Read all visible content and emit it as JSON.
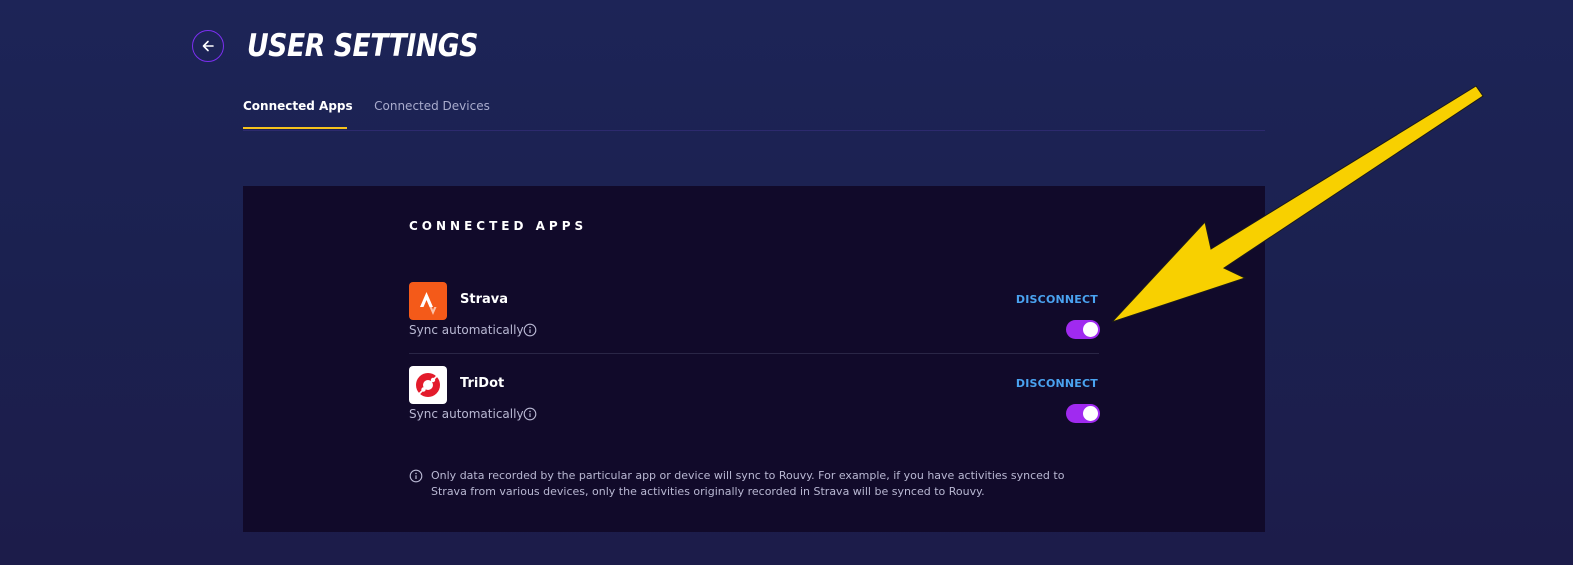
{
  "header": {
    "title": "USER SETTINGS",
    "back_icon": "arrow-left-icon"
  },
  "tabs": [
    {
      "label": "Connected Apps",
      "active": true
    },
    {
      "label": "Connected Devices",
      "active": false
    }
  ],
  "section": {
    "title": "CONNECTED APPS"
  },
  "apps": [
    {
      "name": "Strava",
      "logo_icon": "strava-logo-icon",
      "action_label": "DISCONNECT",
      "sync_label": "Sync automatically",
      "sync_enabled": true
    },
    {
      "name": "TriDot",
      "logo_icon": "tridot-logo-icon",
      "action_label": "DISCONNECT",
      "sync_label": "Sync automatically",
      "sync_enabled": true
    }
  ],
  "footnote": {
    "text": "Only data recorded by the particular app or device will sync to Rouvy. For example, if you have activities synced to Strava from various devices, only the activities originally recorded in Strava will be synced to Rouvy."
  },
  "colors": {
    "background": "#1d2457",
    "panel": "#110a2a",
    "accent_purple": "#a02af0",
    "link_blue": "#4aa3f0",
    "tab_underline": "#f6c21c",
    "annotation_arrow": "#f8d000"
  }
}
